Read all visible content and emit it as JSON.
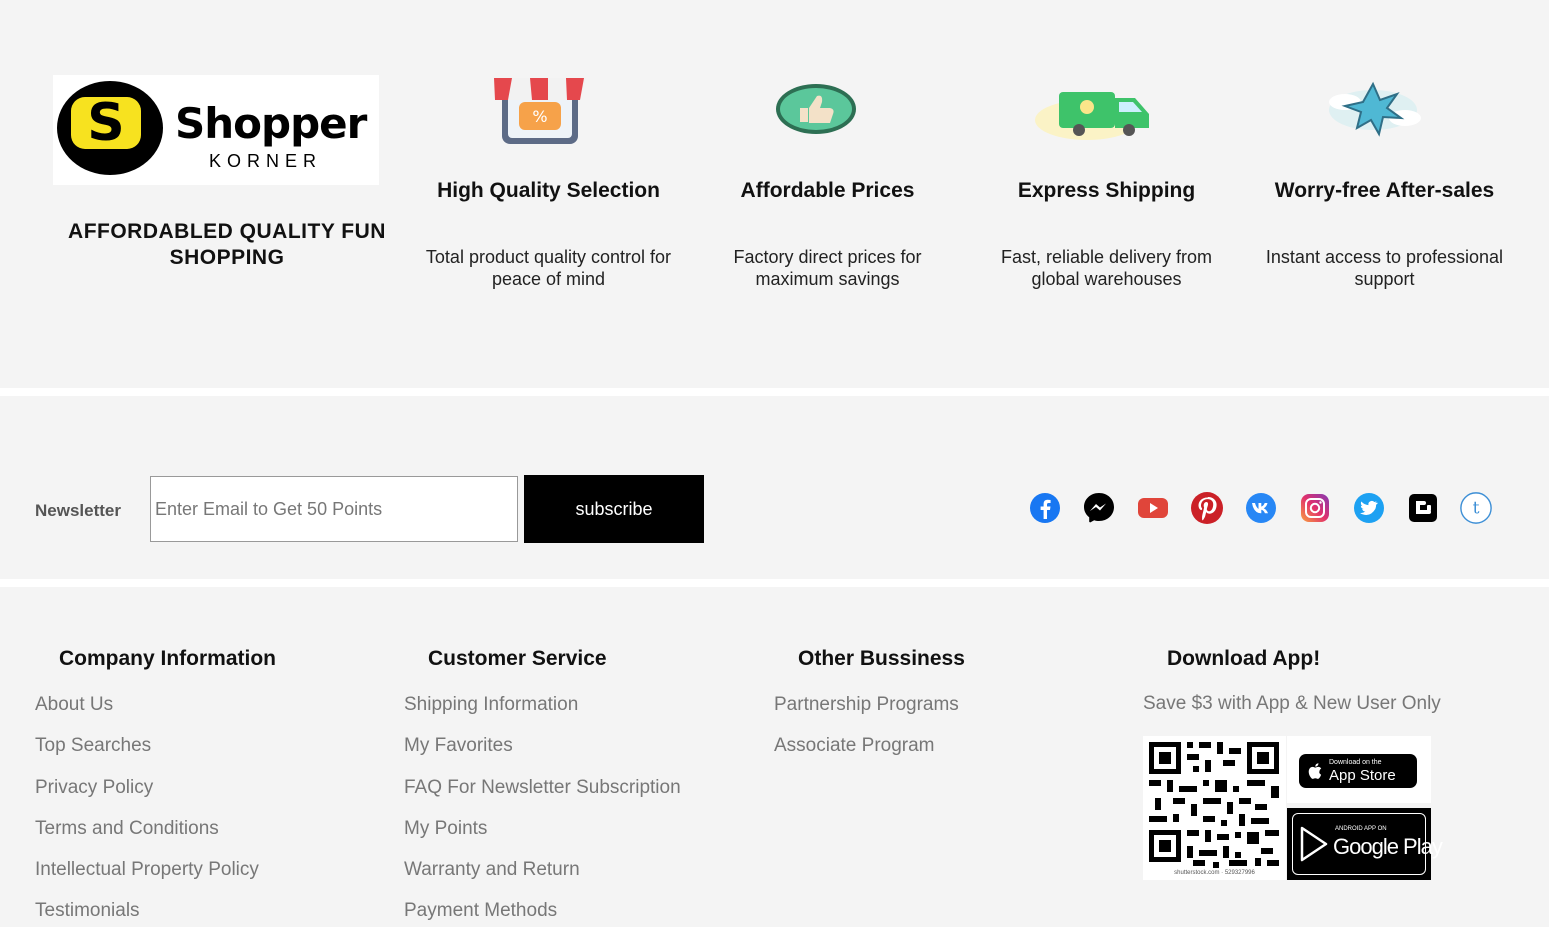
{
  "brand": {
    "logo_word": "Shopper",
    "logo_sub": "KORNER",
    "logo_letter": "S",
    "tagline_line1": "AFFORDABLED QUALITY FUN",
    "tagline_line2": "SHOPPING"
  },
  "features": [
    {
      "icon": "storefront-percent-icon",
      "title": "High Quality Selection",
      "desc_line1": "Total product quality control for",
      "desc_line2": "peace of mind"
    },
    {
      "icon": "thumbs-up-icon",
      "title": "Affordable Prices",
      "desc_line1": "Factory direct prices for",
      "desc_line2": "maximum savings"
    },
    {
      "icon": "delivery-truck-icon",
      "title": "Express Shipping",
      "desc_line1": "Fast, reliable delivery from",
      "desc_line2": "global warehouses"
    },
    {
      "icon": "sparkle-cloud-icon",
      "title": "Worry-free After-sales",
      "desc_line1": "Instant access to professional",
      "desc_line2": "support"
    }
  ],
  "newsletter": {
    "label": "Newsletter",
    "placeholder": "Enter Email to Get 50 Points",
    "button": "subscribe"
  },
  "social": [
    {
      "name": "facebook-icon",
      "color": "#3b5998"
    },
    {
      "name": "messenger-icon",
      "color": "#000000"
    },
    {
      "name": "youtube-icon",
      "color": "#e03a3a"
    },
    {
      "name": "pinterest-icon",
      "color": "#cb2027"
    },
    {
      "name": "vk-icon",
      "color": "#2787f5"
    },
    {
      "name": "instagram-icon",
      "color": "#c13584"
    },
    {
      "name": "twitter-icon",
      "color": "#1da1f2"
    },
    {
      "name": "blogger-icon",
      "color": "#000000"
    },
    {
      "name": "tumblr-icon",
      "color": "#3d8fd6"
    }
  ],
  "footer": {
    "company": {
      "title": "Company Information",
      "links": [
        "About Us",
        "Top Searches",
        "Privacy Policy",
        "Terms and Conditions",
        "Intellectual Property Policy",
        "Testimonials"
      ]
    },
    "service": {
      "title": "Customer Service",
      "links": [
        "Shipping Information",
        "My Favorites",
        "FAQ For Newsletter Subscription",
        "My Points",
        "Warranty and Return",
        "Payment Methods"
      ]
    },
    "business": {
      "title": "Other Bussiness",
      "links": [
        "Partnership Programs",
        "Associate Program"
      ]
    },
    "app": {
      "title": "Download App!",
      "note": "Save $3 with App & New User Only",
      "qr_caption": "shutterstock.com · 529327996",
      "appstore_small": "Download on the",
      "appstore_big": "App Store",
      "gplay_small": "ANDROID APP ON",
      "gplay_big": "Google Play"
    }
  },
  "colors": {
    "background": "#f4f4f4",
    "divider": "#ffffff",
    "link": "#777777",
    "logo_yellow": "#f7e21f"
  }
}
